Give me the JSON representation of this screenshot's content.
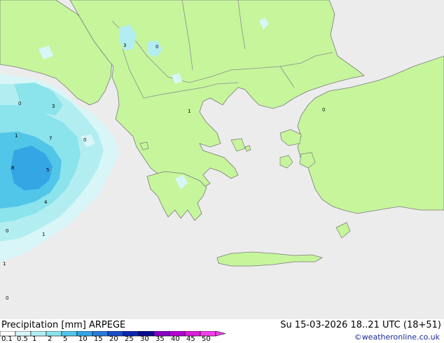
{
  "footer": {
    "title": "Precipitation [mm]  ARPEGE",
    "valid_time": "Su 15-03-2026 18..21 UTC (18+51)",
    "credit": "©weatheronline.co.uk"
  },
  "legend": {
    "ticks": [
      "0.1",
      "0.5",
      "1",
      "2",
      "5",
      "10",
      "15",
      "20",
      "25",
      "30",
      "35",
      "40",
      "45",
      "50"
    ],
    "colors": [
      "#ffffff",
      "#d8f6f7",
      "#b2eef1",
      "#8be3ec",
      "#52c6e9",
      "#34a6e4",
      "#2a7ad8",
      "#1c4ec8",
      "#0e28b2",
      "#0a0a8e",
      "#8800c8",
      "#b400d4",
      "#d820d8",
      "#f040e8"
    ]
  },
  "map": {
    "colors": {
      "sea": "#ececec",
      "land": "#c6f59c",
      "border": "#8c8c8c",
      "coast": "#7a7a7a"
    },
    "rain_labels": [
      "3",
      "0",
      "0",
      "3",
      "0",
      "1",
      "1",
      "7",
      "0",
      "8",
      "5",
      "4",
      "1",
      "0",
      "1",
      "0"
    ]
  }
}
